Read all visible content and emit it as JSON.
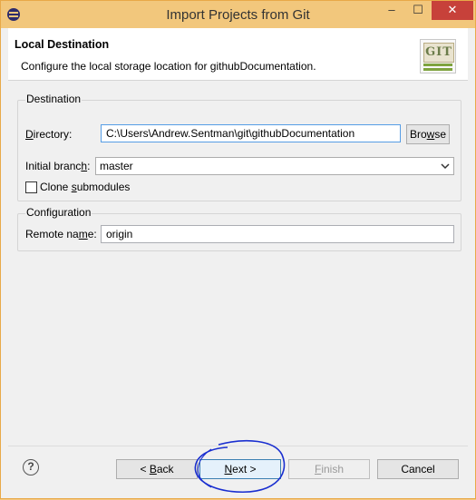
{
  "window": {
    "title": "Import Projects from Git",
    "controls": {
      "minimize": "–",
      "maximize": "☐",
      "close": "✕"
    }
  },
  "header": {
    "title": "Local Destination",
    "description": "Configure the local storage location for githubDocumentation.",
    "logo_text": "GIT"
  },
  "destination": {
    "group_title": "Destination",
    "directory_label_accel": "D",
    "directory_label_rest": "irectory:",
    "directory_value": "C:\\Users\\Andrew.Sentman\\git\\githubDocumentation",
    "browse_pre": "Bro",
    "browse_accel": "w",
    "browse_post": "se",
    "branch_label_pre": "Initial branc",
    "branch_label_accel": "h",
    "branch_label_post": ":",
    "branch_value": "master",
    "clone_pre": "Clone ",
    "clone_accel": "s",
    "clone_post": "ubmodules",
    "clone_checked": false
  },
  "configuration": {
    "group_title": "Configuration",
    "remote_label_pre": "Remote na",
    "remote_label_accel": "m",
    "remote_label_post": "e:",
    "remote_value": "origin"
  },
  "footer": {
    "help": "?",
    "back_pre": "< ",
    "back_accel": "B",
    "back_post": "ack",
    "next_accel": "N",
    "next_post": "ext >",
    "finish_accel": "F",
    "finish_post": "inish",
    "cancel": "Cancel"
  },
  "colors": {
    "titlebar": "#f2c77c",
    "close_button": "#c7413a",
    "annotation_ink": "#1a2fd0"
  }
}
